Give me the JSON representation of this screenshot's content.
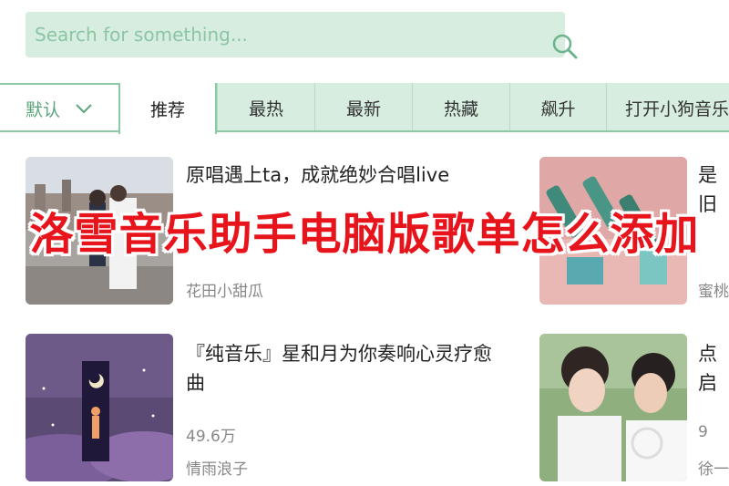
{
  "search": {
    "placeholder": "Search for something..."
  },
  "tabs": {
    "default_label": "默认",
    "active_label": "推荐",
    "items": [
      "最热",
      "最新",
      "热藏",
      "飙升",
      "打开小狗音乐"
    ]
  },
  "cards": [
    {
      "title": "原唱遇上ta，成就绝妙合唱live",
      "count": "",
      "author": "花田小甜瓜"
    },
    {
      "title": "是旧氛",
      "count": "",
      "author": "蜜桃"
    },
    {
      "title": "『纯音乐』星和月为你奏响心灵疗愈曲",
      "count": "49.6万",
      "author": "情雨浪子"
    },
    {
      "title": "点启",
      "count": "9",
      "author": "徐一"
    }
  ],
  "banner": {
    "text": "洛雪音乐助手电脑版歌单怎么添加"
  },
  "colors": {
    "accent": "#8ccaa6",
    "search_bg": "#d6ede0",
    "banner_text": "#e8141c"
  }
}
